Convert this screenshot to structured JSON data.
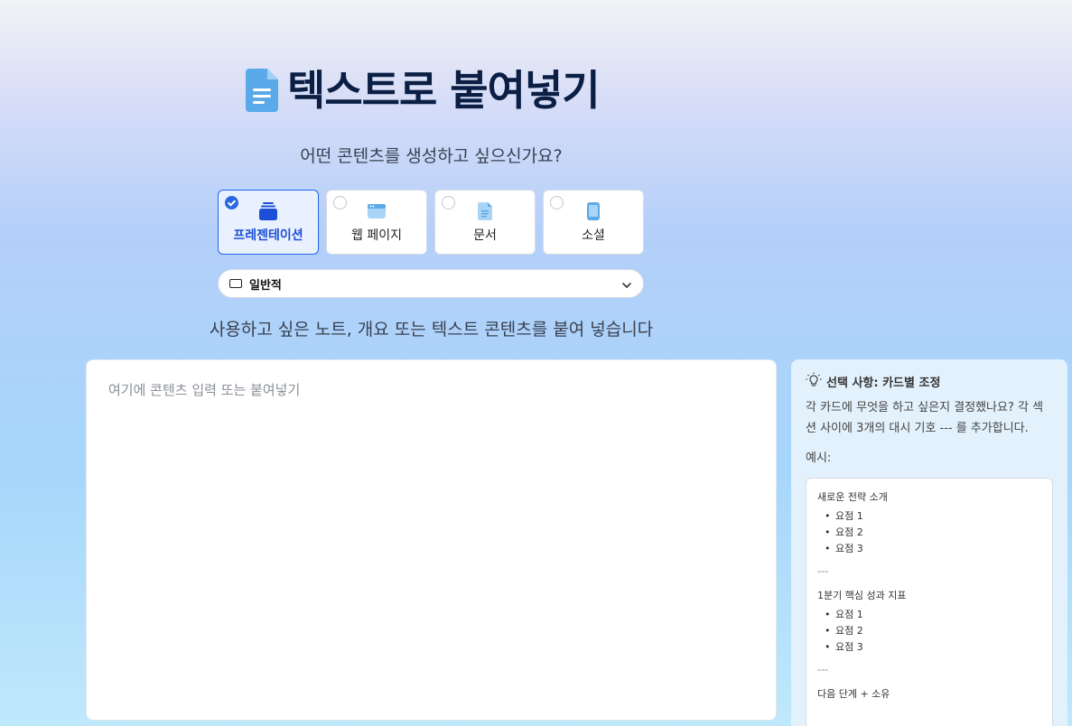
{
  "header": {
    "title": "텍스트로 붙여넣기"
  },
  "question": "어떤 콘텐츠를 생성하고 싶으신가요?",
  "content_types": [
    {
      "label": "프레젠테이션",
      "selected": true,
      "icon": "presentation-icon"
    },
    {
      "label": "웹 페이지",
      "selected": false,
      "icon": "webpage-icon"
    },
    {
      "label": "문서",
      "selected": false,
      "icon": "document-icon"
    },
    {
      "label": "소셜",
      "selected": false,
      "icon": "mobile-icon"
    }
  ],
  "dropdown": {
    "value": "일반적",
    "icon": "rectangle-icon"
  },
  "instruction": "사용하고 싶은 노트, 개요 또는 텍스트 콘텐츠를 붙여 넣습니다",
  "editor": {
    "placeholder": "여기에 콘텐츠 입력 또는 붙여넣기",
    "value": ""
  },
  "side_panel": {
    "title": "선택 사항: 카드별 조정",
    "description": "각 카드에 무엇을 하고 싶은지 결정했나요? 각 섹션 사이에 3개의 대시 기호 --- 를 추가합니다.",
    "example_label": "예시:",
    "example": {
      "sections": [
        {
          "title": "새로운 전략 소개",
          "items": [
            "요점 1",
            "요점 2",
            "요점 3"
          ]
        },
        {
          "title": "1분기 핵심 성과 지표",
          "items": [
            "요점 1",
            "요점 2",
            "요점 3"
          ]
        },
        {
          "title": "다음 단계 + 소유",
          "items": []
        }
      ],
      "divider": "---"
    }
  },
  "colors": {
    "accent": "#2563eb",
    "title": "#0b1f45",
    "icon_blue": "#5aa9e8"
  }
}
